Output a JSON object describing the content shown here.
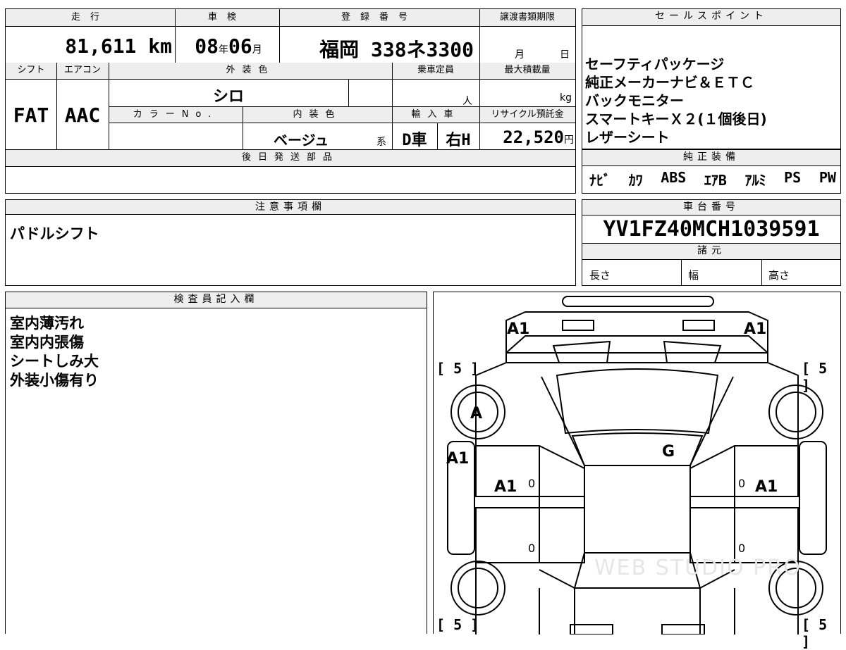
{
  "headers": {
    "mileage": "走行",
    "inspection": "車検",
    "registration": "登録番号",
    "transfer_deadline": "譲渡書類期限",
    "shift": "シフト",
    "aircon": "エアコン",
    "exterior_color": "外装色",
    "capacity": "乗車定員",
    "max_load": "最大積載量",
    "color_no": "カラーNo.",
    "interior_color": "内装色",
    "import": "輸入車",
    "recycle_fee": "リサイクル預託金",
    "later_parts": "後日発送部品",
    "notes": "注意事項欄",
    "sales_points": "セールスポイント",
    "factory_equipment": "純正装備",
    "chassis_no": "車台番号",
    "specs": "諸元",
    "inspector": "検査員記入欄"
  },
  "vehicle": {
    "mileage_value": "81,611",
    "mileage_unit": "km",
    "inspection_year": "08",
    "inspection_year_unit": "年",
    "inspection_month": "06",
    "inspection_month_unit": "月",
    "registration_number": "福岡 338ネ3300",
    "transfer_month_unit": "月",
    "transfer_day_unit": "日",
    "shift_value": "FAT",
    "aircon_value": "AAC",
    "exterior_color_value": "シロ",
    "capacity_unit": "人",
    "max_load_unit": "kg",
    "interior_color_value": "ベージュ",
    "interior_color_suffix": "系",
    "import_type": "D車",
    "steering": "右H",
    "recycle_fee_value": "22,520",
    "recycle_fee_unit": "円",
    "chassis_number": "YV1FZ40MCH1039591",
    "spec_length": "長さ",
    "spec_width": "幅",
    "spec_height": "高さ"
  },
  "sales_points": [
    "セーフティパッケージ",
    "純正メーカーナビ＆ＥＴＣ",
    "バックモニター",
    "スマートキーＸ２(１個後日)",
    "レザーシート"
  ],
  "factory_equipment": [
    "ﾅﾋﾞ",
    "ｶﾜ",
    "ABS",
    "ｴｱB",
    "ｱﾙﾐ",
    "PS",
    "PW"
  ],
  "notes_text": "パドルシフト",
  "inspector_notes": [
    "室内薄汚れ",
    "室内内張傷",
    "シートしみ大",
    "外装小傷有り"
  ],
  "diagram": {
    "marks": {
      "front_left_corner": "A1",
      "front_right_corner": "A1",
      "left_front_fender": "A1",
      "left_front_door": "A1",
      "right_front_door": "A1",
      "left_front_wheel": "A",
      "windshield": "G",
      "door_zero_1": "0",
      "door_zero_2": "0",
      "door_zero_3": "0",
      "door_zero_4": "0"
    },
    "tires": [
      "[ 5 ]",
      "[ 5 ]",
      "[ 5 ]",
      "[ 5 ]"
    ],
    "watermark": "WEB STUDIO PRO"
  }
}
